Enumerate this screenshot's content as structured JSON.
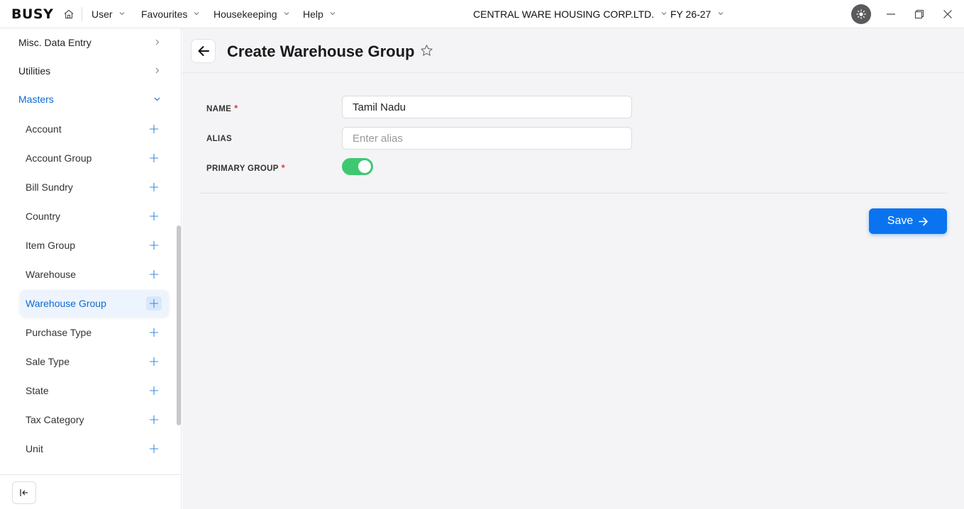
{
  "topbar": {
    "logo": "BUSY",
    "menus": [
      {
        "label": "User"
      },
      {
        "label": "Favourites"
      },
      {
        "label": "Housekeeping"
      },
      {
        "label": "Help"
      }
    ],
    "company": "CENTRAL WARE HOUSING CORP.LTD.",
    "fiscal_year": "FY 26-27"
  },
  "sidebar": {
    "groups": [
      {
        "label": "Misc. Data Entry",
        "state": "collapsed"
      },
      {
        "label": "Utilities",
        "state": "collapsed"
      },
      {
        "label": "Masters",
        "state": "expanded"
      }
    ],
    "masters": [
      {
        "label": "Account"
      },
      {
        "label": "Account Group"
      },
      {
        "label": "Bill Sundry"
      },
      {
        "label": "Country"
      },
      {
        "label": "Item Group"
      },
      {
        "label": "Warehouse"
      },
      {
        "label": "Warehouse Group",
        "selected": true
      },
      {
        "label": "Purchase Type"
      },
      {
        "label": "Sale Type"
      },
      {
        "label": "State"
      },
      {
        "label": "Tax Category"
      },
      {
        "label": "Unit"
      }
    ]
  },
  "main": {
    "title": "Create Warehouse Group",
    "form": {
      "name_label": "NAME",
      "name_value": "Tamil Nadu",
      "alias_label": "ALIAS",
      "alias_placeholder": "Enter alias",
      "primary_group_label": "PRIMARY GROUP",
      "primary_group_on": true,
      "required_mark": "*"
    },
    "save_label": "Save"
  },
  "colors": {
    "accent": "#0a74f0",
    "toggle_on": "#3ec971",
    "required": "#e03a3a",
    "selected_text": "#0b6bd3"
  }
}
